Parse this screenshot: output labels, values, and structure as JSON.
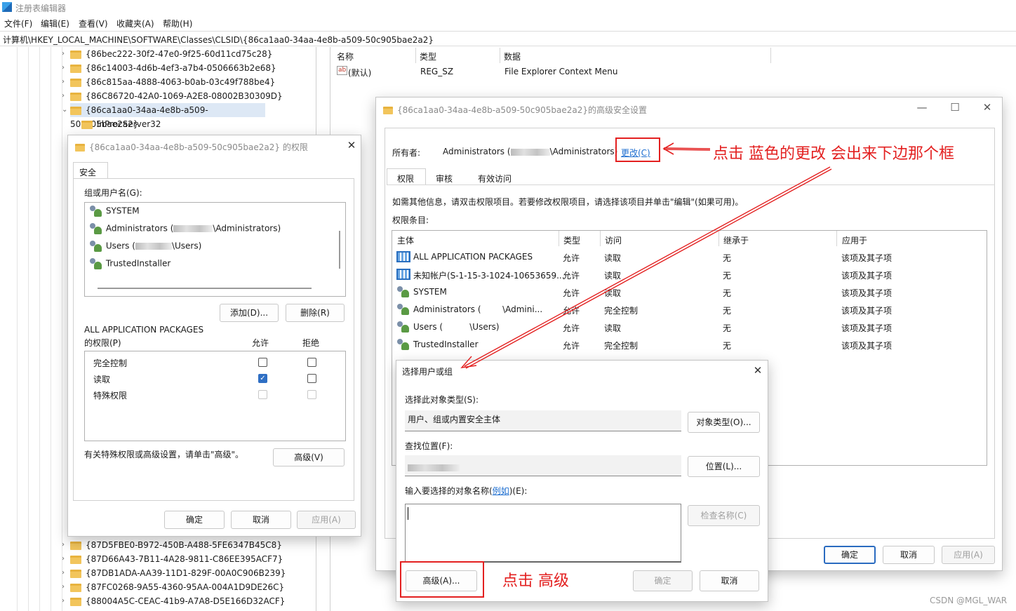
{
  "app": {
    "title": "注册表编辑器",
    "menu": [
      "文件(F)",
      "编辑(E)",
      "查看(V)",
      "收藏夹(A)",
      "帮助(H)"
    ],
    "address": "计算机\\HKEY_LOCAL_MACHINE\\SOFTWARE\\Classes\\CLSID\\{86ca1aa0-34aa-4e8b-a509-50c905bae2a2}"
  },
  "tree": {
    "top_items": [
      "{86bec222-30f2-47e0-9f25-60d11cd75c28}",
      "{86c14003-4d6b-4ef3-a7b4-0506663b2e68}",
      "{86c815aa-4888-4063-b0ab-03c49f788be4}",
      "{86C86720-42A0-1069-A2E8-08002B30309D}",
      "{86ca1aa0-34aa-4e8b-a509-50c905bae2a2}"
    ],
    "child": "InProcServer32",
    "bottom_items": [
      "{87D5FBE0-B972-450B-A488-5FE6347B45C8}",
      "{87D66A43-7B11-4A28-9811-C86EE395ACF7}",
      "{87DB1ADA-AA39-11D1-829F-00A0C906B239}",
      "{87FC0268-9A55-4360-95AA-004A1D9DE26C}",
      "{88004A5C-CEAC-41b9-A7A8-D5E166D32ACF}"
    ]
  },
  "values_panel": {
    "headers": [
      "名称",
      "类型",
      "数据"
    ],
    "row": {
      "name": "(默认)",
      "type": "REG_SZ",
      "data": "File Explorer Context Menu",
      "icon_text": "ab"
    }
  },
  "perm_dialog": {
    "title": "{86ca1aa0-34aa-4e8b-a509-50c905bae2a2} 的权限",
    "tab": "安全",
    "group_label": "组或用户名(G):",
    "users": [
      {
        "name": "SYSTEM",
        "suffix": ""
      },
      {
        "name": "Administrators (",
        "suffix": "\\Administrators)"
      },
      {
        "name": "Users (",
        "suffix": "\\Users)"
      },
      {
        "name": "TrustedInstaller",
        "suffix": ""
      }
    ],
    "add_btn": "添加(D)...",
    "remove_btn": "删除(R)",
    "selected_principal": "ALL APPLICATION PACKAGES",
    "perm_label": "的权限(P)",
    "allow": "允许",
    "deny": "拒绝",
    "permissions": [
      {
        "name": "完全控制",
        "allow": false,
        "deny": false,
        "disabled": false
      },
      {
        "name": "读取",
        "allow": true,
        "deny": false,
        "disabled": false
      },
      {
        "name": "特殊权限",
        "allow": false,
        "deny": false,
        "disabled": true
      }
    ],
    "advanced_hint": "有关特殊权限或高级设置，请单击\"高级\"。",
    "advanced_btn": "高级(V)",
    "ok": "确定",
    "cancel": "取消",
    "apply": "应用(A)"
  },
  "adv_dialog": {
    "title": "{86ca1aa0-34aa-4e8b-a509-50c905bae2a2}的高级安全设置",
    "owner_label": "所有者:",
    "owner_prefix": "Administrators (",
    "owner_suffix": "\\Administrators)",
    "change_link": "更改(C)",
    "tabs": [
      "权限",
      "审核",
      "有效访问"
    ],
    "info": "如需其他信息，请双击权限项目。若要修改权限项目，请选择该项目并单击\"编辑\"(如果可用)。",
    "entries_label": "权限条目:",
    "columns": [
      "主体",
      "类型",
      "访问",
      "继承于",
      "应用于"
    ],
    "rows": [
      {
        "principal": "ALL APPLICATION PACKAGES",
        "type": "允许",
        "access": "读取",
        "inherit": "无",
        "apply": "该项及其子项",
        "icon": "pkg"
      },
      {
        "principal": "未知帐户(S-1-15-3-1024-10653659...",
        "type": "允许",
        "access": "读取",
        "inherit": "无",
        "apply": "该项及其子项",
        "icon": "pkg"
      },
      {
        "principal": "SYSTEM",
        "type": "允许",
        "access": "读取",
        "inherit": "无",
        "apply": "该项及其子项",
        "icon": "user"
      },
      {
        "principal": "Administrators (        \\Admini...",
        "type": "允许",
        "access": "完全控制",
        "inherit": "无",
        "apply": "该项及其子项",
        "icon": "user"
      },
      {
        "principal": "Users (          \\Users)",
        "type": "允许",
        "access": "读取",
        "inherit": "无",
        "apply": "该项及其子项",
        "icon": "user"
      },
      {
        "principal": "TrustedInstaller",
        "type": "允许",
        "access": "完全控制",
        "inherit": "无",
        "apply": "该项及其子项",
        "icon": "user"
      }
    ],
    "ok": "确定",
    "cancel": "取消",
    "apply": "应用(A)"
  },
  "select_dialog": {
    "title": "选择用户或组",
    "obj_type_label": "选择此对象类型(S):",
    "obj_type_value": "用户、组或内置安全主体",
    "obj_type_btn": "对象类型(O)...",
    "location_label": "查找位置(F):",
    "location_btn": "位置(L)...",
    "enter_label_prefix": "输入要选择的对象名称(",
    "enter_label_link": "例如",
    "enter_label_suffix": ")(E):",
    "check_btn": "检查名称(C)",
    "advanced_btn": "高级(A)...",
    "ok": "确定",
    "cancel": "取消"
  },
  "annotations": {
    "top": "点击 蓝色的更改 会出来下边那个框",
    "bottom": "点击 高级",
    "color": "#e32020"
  },
  "watermark": "CSDN @MGL_WAR"
}
